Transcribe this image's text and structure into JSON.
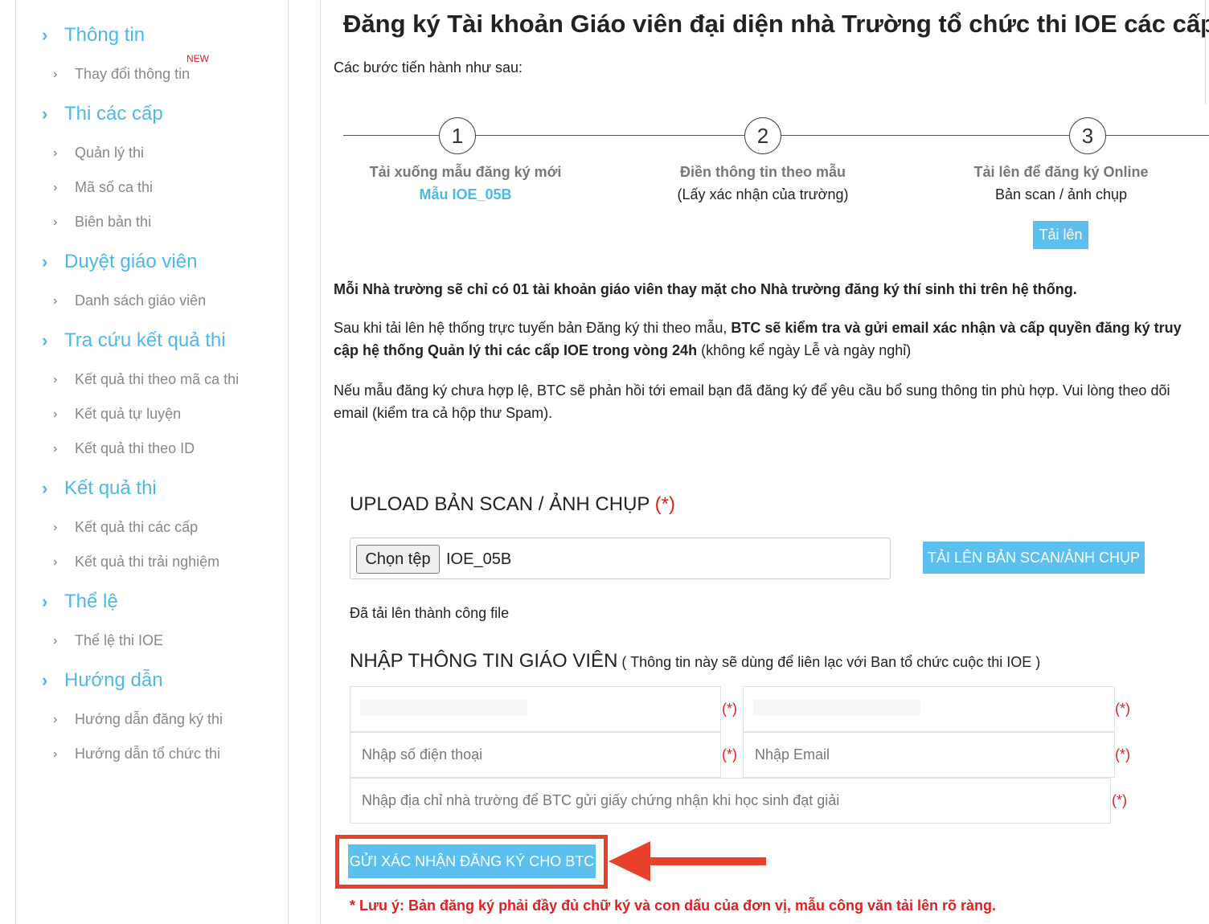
{
  "sidebar": {
    "groups": [
      {
        "title": "Thông tin",
        "items": [
          "Thay đổi thông tin"
        ],
        "badge": "NEW"
      },
      {
        "title": "Thi các cấp",
        "items": [
          "Quản lý thi",
          "Mã số ca thi",
          "Biên bản thi"
        ]
      },
      {
        "title": "Duyệt giáo viên",
        "items": [
          "Danh sách giáo viên"
        ]
      },
      {
        "title": "Tra cứu kết quả thi",
        "items": [
          "Kết quả thi theo mã ca thi",
          "Kết quả tự luyện",
          "Kết quả thi theo ID"
        ]
      },
      {
        "title": "Kết quả thi",
        "items": [
          "Kết quả thi các cấp",
          "Kết quả thi trải nghiệm"
        ]
      },
      {
        "title": "Thể lệ",
        "items": [
          "Thể lệ thi IOE"
        ]
      },
      {
        "title": "Hướng dẫn",
        "items": [
          "Hướng dẫn đăng ký thi",
          "Hướng dẫn tổ chức thi"
        ]
      }
    ]
  },
  "main": {
    "title": "Đăng ký Tài khoản Giáo viên đại diện nhà Trường tổ chức thi IOE các cấp",
    "intro": "Các bước tiến hành như sau:",
    "steps": [
      {
        "num": "1",
        "title": "Tải xuống mẫu đăng ký mới",
        "sub": "Mẫu IOE_05B"
      },
      {
        "num": "2",
        "title": "Điền thông tin theo mẫu",
        "sub": "(Lấy xác nhận của trường)"
      },
      {
        "num": "3",
        "title": "Tải lên để đăng ký Online",
        "sub": "Bản scan / ảnh chụp",
        "button": "Tải lên"
      }
    ],
    "para1": "Mỗi Nhà trường sẽ chỉ có 01 tài khoản giáo viên thay mặt cho Nhà trường đăng ký thí sinh thi trên hệ thống.",
    "para2_start": "Sau khi tải lên hệ thống trực tuyến bản Đăng ký thi theo mẫu, ",
    "para2_bold": "BTC sẽ kiểm tra và gửi email xác nhận và cấp quyền đăng ký truy cập hệ thống Quản lý thi các cấp IOE trong vòng 24h",
    "para2_end": " (không kể ngày Lễ và ngày nghỉ)",
    "para3": "Nếu mẫu đăng ký chưa hợp lệ, BTC sẽ phản hồi tới email bạn đã đăng ký để yêu cầu bổ sung thông tin phù hợp. Vui lòng theo dõi email (kiểm tra cả hộp thư Spam).",
    "upload": {
      "title": "UPLOAD BẢN SCAN / ẢNH CHỤP",
      "required": "(*)",
      "choose_label": "Chọn tệp",
      "file_name": "IOE_05B",
      "upload_button": "TẢI LÊN BẢN SCAN/ẢNH CHỤP",
      "success": "Đã tải lên thành công file"
    },
    "teacher": {
      "title": "NHẬP THÔNG TIN GIÁO VIÊN",
      "note": " ( Thông tin này sẽ dùng để liên lạc với Ban tổ chức cuộc thi IOE )",
      "required": "(*)",
      "phone_placeholder": "Nhập số điện thoại",
      "email_placeholder": "Nhập Email",
      "address_placeholder": "Nhập địa chỉ nhà trường để BTC gửi giấy chứng nhận khi học sinh đạt giải",
      "submit": "GỬI XÁC NHẬN ĐĂNG KÝ CHO BTC"
    },
    "warning": "* Lưu ý: Bản đăng ký phải đầy đủ chữ ký và con dấu của đơn vị, mẫu công văn tải lên rõ ràng."
  },
  "colors": {
    "accent": "#5bc0f0",
    "link": "#4db8e8",
    "required": "#e02020",
    "highlight": "#e8402a"
  }
}
